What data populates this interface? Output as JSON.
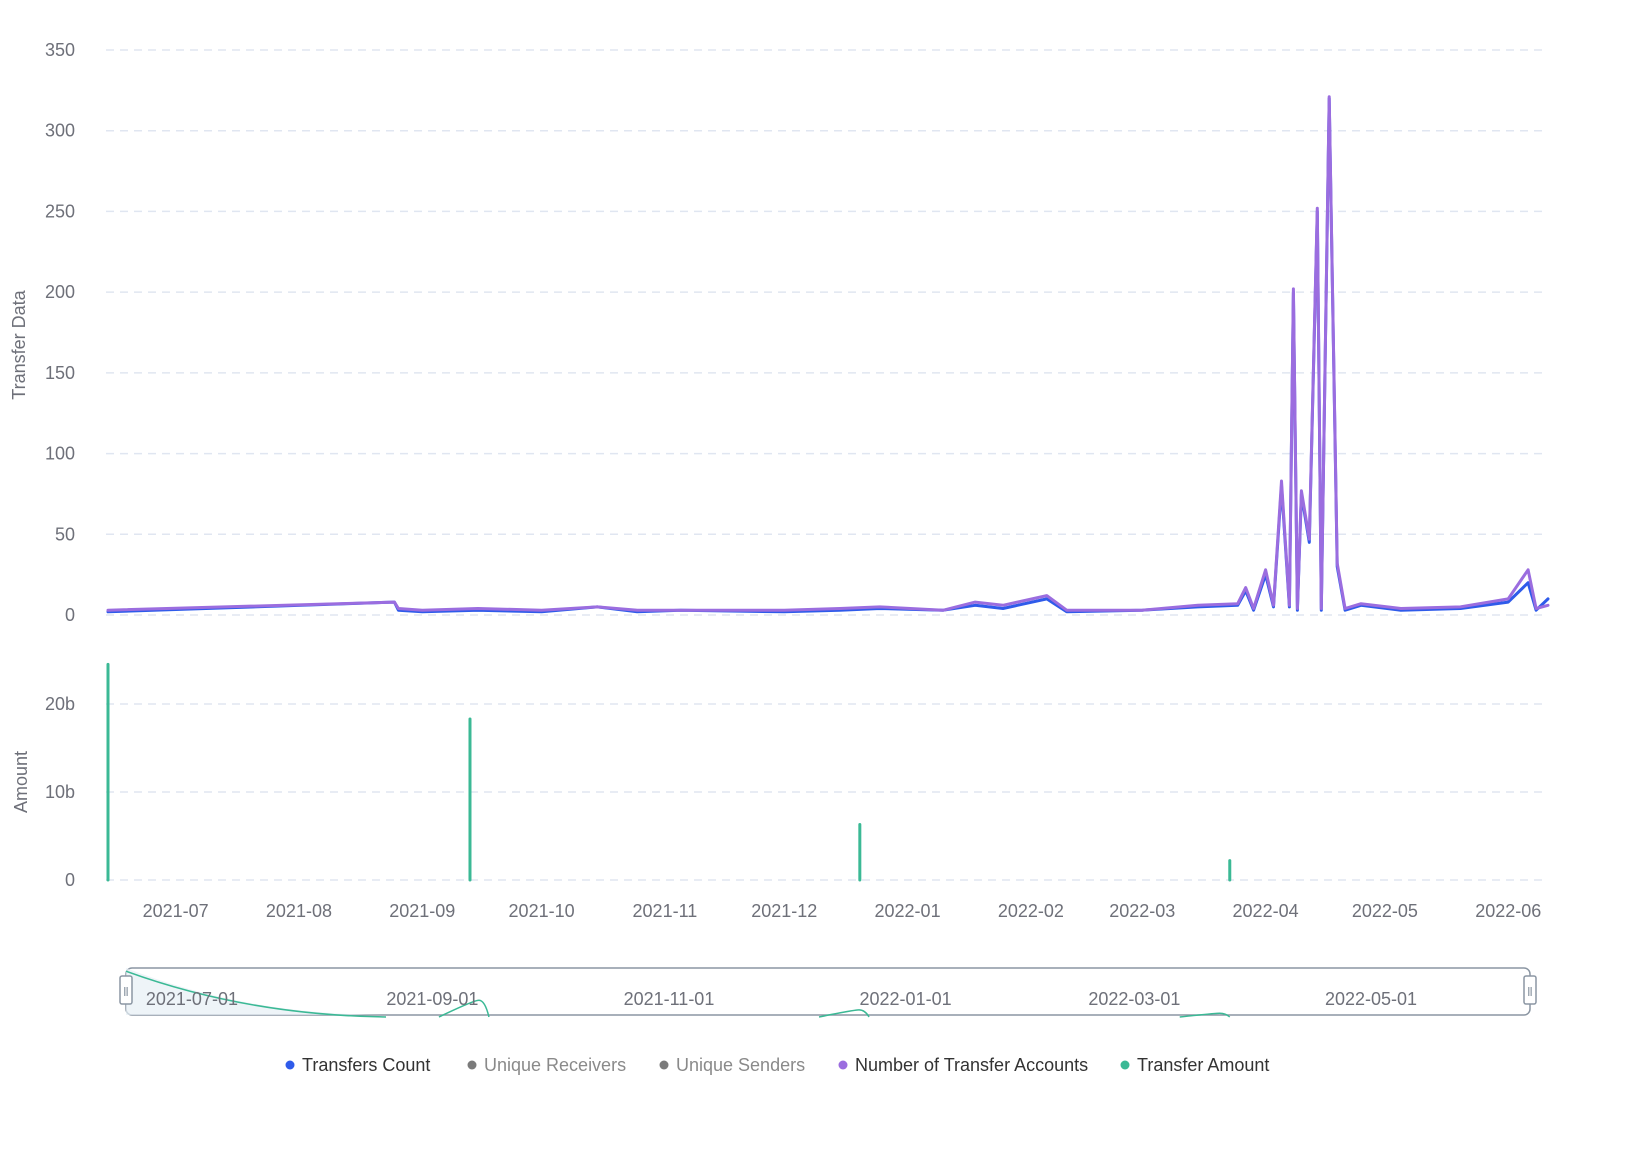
{
  "colors": {
    "transfers_count": "#2f5bea",
    "unique_receivers": "#7b7b7b",
    "unique_senders": "#7b7b7b",
    "transfer_accounts": "#9b6ddf",
    "transfer_amount": "#3bb995",
    "legend_active_text": "#333333",
    "legend_inactive_text": "#8a8a8a"
  },
  "chart_data": [
    {
      "type": "line",
      "ylabel": "Transfer Data",
      "ylim": [
        0,
        350
      ],
      "y_ticks": [
        "0",
        "50",
        "100",
        "150",
        "200",
        "250",
        "300",
        "350"
      ],
      "grid": true,
      "series": [
        {
          "name": "Transfers Count",
          "points": [
            [
              "2021-06-14",
              2
            ],
            [
              "2021-08-25",
              8
            ],
            [
              "2021-08-26",
              3
            ],
            [
              "2021-09-01",
              2
            ],
            [
              "2021-09-15",
              3
            ],
            [
              "2021-10-01",
              2
            ],
            [
              "2021-10-15",
              5
            ],
            [
              "2021-10-25",
              2
            ],
            [
              "2021-11-05",
              3
            ],
            [
              "2021-12-01",
              2
            ],
            [
              "2021-12-15",
              3
            ],
            [
              "2021-12-25",
              4
            ],
            [
              "2022-01-10",
              3
            ],
            [
              "2022-01-18",
              6
            ],
            [
              "2022-01-25",
              4
            ],
            [
              "2022-02-05",
              10
            ],
            [
              "2022-02-10",
              2
            ],
            [
              "2022-03-01",
              3
            ],
            [
              "2022-03-15",
              5
            ],
            [
              "2022-03-25",
              6
            ],
            [
              "2022-03-27",
              15
            ],
            [
              "2022-03-29",
              3
            ],
            [
              "2022-04-01",
              25
            ],
            [
              "2022-04-03",
              5
            ],
            [
              "2022-04-05",
              80
            ],
            [
              "2022-04-07",
              5
            ],
            [
              "2022-04-08",
              200
            ],
            [
              "2022-04-09",
              3
            ],
            [
              "2022-04-10",
              75
            ],
            [
              "2022-04-12",
              45
            ],
            [
              "2022-04-14",
              250
            ],
            [
              "2022-04-15",
              3
            ],
            [
              "2022-04-17",
              320
            ],
            [
              "2022-04-19",
              30
            ],
            [
              "2022-04-21",
              3
            ],
            [
              "2022-04-25",
              6
            ],
            [
              "2022-05-05",
              3
            ],
            [
              "2022-05-20",
              4
            ],
            [
              "2022-06-01",
              8
            ],
            [
              "2022-06-06",
              20
            ],
            [
              "2022-06-08",
              3
            ],
            [
              "2022-06-11",
              10
            ]
          ]
        },
        {
          "name": "Unique Receivers",
          "hidden": true,
          "points": []
        },
        {
          "name": "Unique Senders",
          "hidden": true,
          "points": []
        },
        {
          "name": "Number of Transfer Accounts",
          "points": [
            [
              "2021-06-14",
              3
            ],
            [
              "2021-08-25",
              8
            ],
            [
              "2021-08-26",
              4
            ],
            [
              "2021-09-01",
              3
            ],
            [
              "2021-09-15",
              4
            ],
            [
              "2021-10-01",
              3
            ],
            [
              "2021-10-15",
              5
            ],
            [
              "2021-10-25",
              3
            ],
            [
              "2021-11-05",
              3
            ],
            [
              "2021-12-01",
              3
            ],
            [
              "2021-12-15",
              4
            ],
            [
              "2021-12-25",
              5
            ],
            [
              "2022-01-10",
              3
            ],
            [
              "2022-01-18",
              8
            ],
            [
              "2022-01-25",
              6
            ],
            [
              "2022-02-05",
              12
            ],
            [
              "2022-02-10",
              3
            ],
            [
              "2022-03-01",
              3
            ],
            [
              "2022-03-15",
              6
            ],
            [
              "2022-03-25",
              7
            ],
            [
              "2022-03-27",
              17
            ],
            [
              "2022-03-29",
              4
            ],
            [
              "2022-04-01",
              28
            ],
            [
              "2022-04-03",
              6
            ],
            [
              "2022-04-05",
              83
            ],
            [
              "2022-04-07",
              6
            ],
            [
              "2022-04-08",
              202
            ],
            [
              "2022-04-09",
              4
            ],
            [
              "2022-04-10",
              77
            ],
            [
              "2022-04-12",
              47
            ],
            [
              "2022-04-14",
              252
            ],
            [
              "2022-04-15",
              4
            ],
            [
              "2022-04-17",
              321
            ],
            [
              "2022-04-19",
              32
            ],
            [
              "2022-04-21",
              4
            ],
            [
              "2022-04-25",
              7
            ],
            [
              "2022-05-05",
              4
            ],
            [
              "2022-05-20",
              5
            ],
            [
              "2022-06-01",
              10
            ],
            [
              "2022-06-06",
              28
            ],
            [
              "2022-06-08",
              4
            ],
            [
              "2022-06-11",
              6
            ]
          ]
        }
      ]
    },
    {
      "type": "bar",
      "ylabel": "Amount",
      "ylim": [
        0,
        25
      ],
      "y_ticks": [
        "0",
        "10b",
        "20b"
      ],
      "grid": true,
      "series": [
        {
          "name": "Transfer Amount",
          "unit": "billions",
          "points": [
            [
              "2021-06-14",
              24.5
            ],
            [
              "2021-09-13",
              18.3
            ],
            [
              "2021-12-20",
              6.3
            ],
            [
              "2022-03-23",
              2.2
            ]
          ]
        }
      ]
    }
  ],
  "x_axis": {
    "ticks": [
      "2021-07",
      "2021-08",
      "2021-09",
      "2021-10",
      "2021-11",
      "2021-12",
      "2022-01",
      "2022-02",
      "2022-03",
      "2022-04",
      "2022-05",
      "2022-06"
    ]
  },
  "zoom_slider": {
    "labels": [
      "2021-07-01",
      "2021-09-01",
      "2021-11-01",
      "2022-01-01",
      "2022-03-01",
      "2022-05-01"
    ],
    "handle_glyph": "Ⅱ"
  },
  "legend": [
    {
      "label": "Transfers Count",
      "color": "#2f5bea",
      "active": true
    },
    {
      "label": "Unique Receivers",
      "color": "#7b7b7b",
      "active": false
    },
    {
      "label": "Unique Senders",
      "color": "#7b7b7b",
      "active": false
    },
    {
      "label": "Number of Transfer Accounts",
      "color": "#9b6ddf",
      "active": true
    },
    {
      "label": "Transfer Amount",
      "color": "#3bb995",
      "active": true
    }
  ]
}
